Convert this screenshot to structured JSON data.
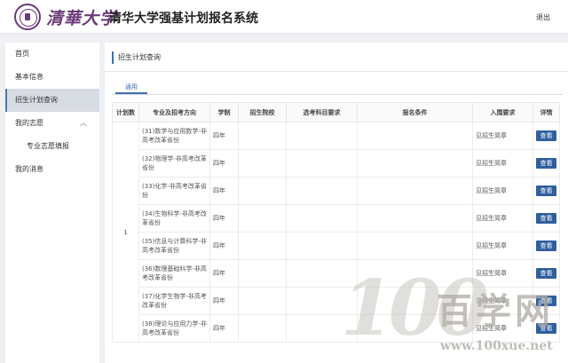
{
  "header": {
    "logo_text": "清華大学",
    "system_title": "清华大学强基计划报名系统",
    "logout": "退出"
  },
  "sidebar": {
    "items": [
      {
        "label": "首页"
      },
      {
        "label": "基本信息"
      },
      {
        "label": "招生计划查询",
        "active": true
      },
      {
        "label": "我的志愿",
        "expandable": true
      },
      {
        "label": "专业志愿填报"
      },
      {
        "label": "我的消息"
      }
    ]
  },
  "main": {
    "section_title": "招生计划查询",
    "tab": "通用",
    "table": {
      "headers": [
        "计划数",
        "专业及招考方向",
        "学制",
        "招生院校",
        "选考科目要求",
        "报名条件",
        "入围要求",
        "详情"
      ],
      "plan_count": "1",
      "rows": [
        {
          "major": "(31)数学与应用数学-非高考改革省份",
          "duration": "四年",
          "requirement": "见招生简章",
          "action": "查看"
        },
        {
          "major": "(32)物理学-非高考改革省份",
          "duration": "四年",
          "requirement": "见招生简章",
          "action": "查看"
        },
        {
          "major": "(33)化学-非高考改革省份",
          "duration": "四年",
          "requirement": "见招生简章",
          "action": "查看"
        },
        {
          "major": "(34)生物科学-非高考改革省份",
          "duration": "四年",
          "requirement": "见招生简章",
          "action": "查看"
        },
        {
          "major": "(35)信息与计算科学-非高考改革省份",
          "duration": "四年",
          "requirement": "见招生简章",
          "action": "查看"
        },
        {
          "major": "(36)数理基础科学-非高考改革省份",
          "duration": "四年",
          "requirement": "见招生简章",
          "action": "查看"
        },
        {
          "major": "(37)化学生物学-非高考改革省份",
          "duration": "四年",
          "requirement": "见招生简章",
          "action": "查看"
        },
        {
          "major": "(38)理论与应用力学-非高考改革省份",
          "duration": "四年",
          "requirement": "见招生简章",
          "action": "查看"
        }
      ]
    }
  },
  "watermark": {
    "number": "100",
    "chinese": "百学网",
    "url": "www.100xue.net"
  },
  "colors": {
    "brand_purple": "#6b3a7a",
    "accent_blue": "#3f6fb0",
    "button_blue": "#2f5f9c"
  }
}
